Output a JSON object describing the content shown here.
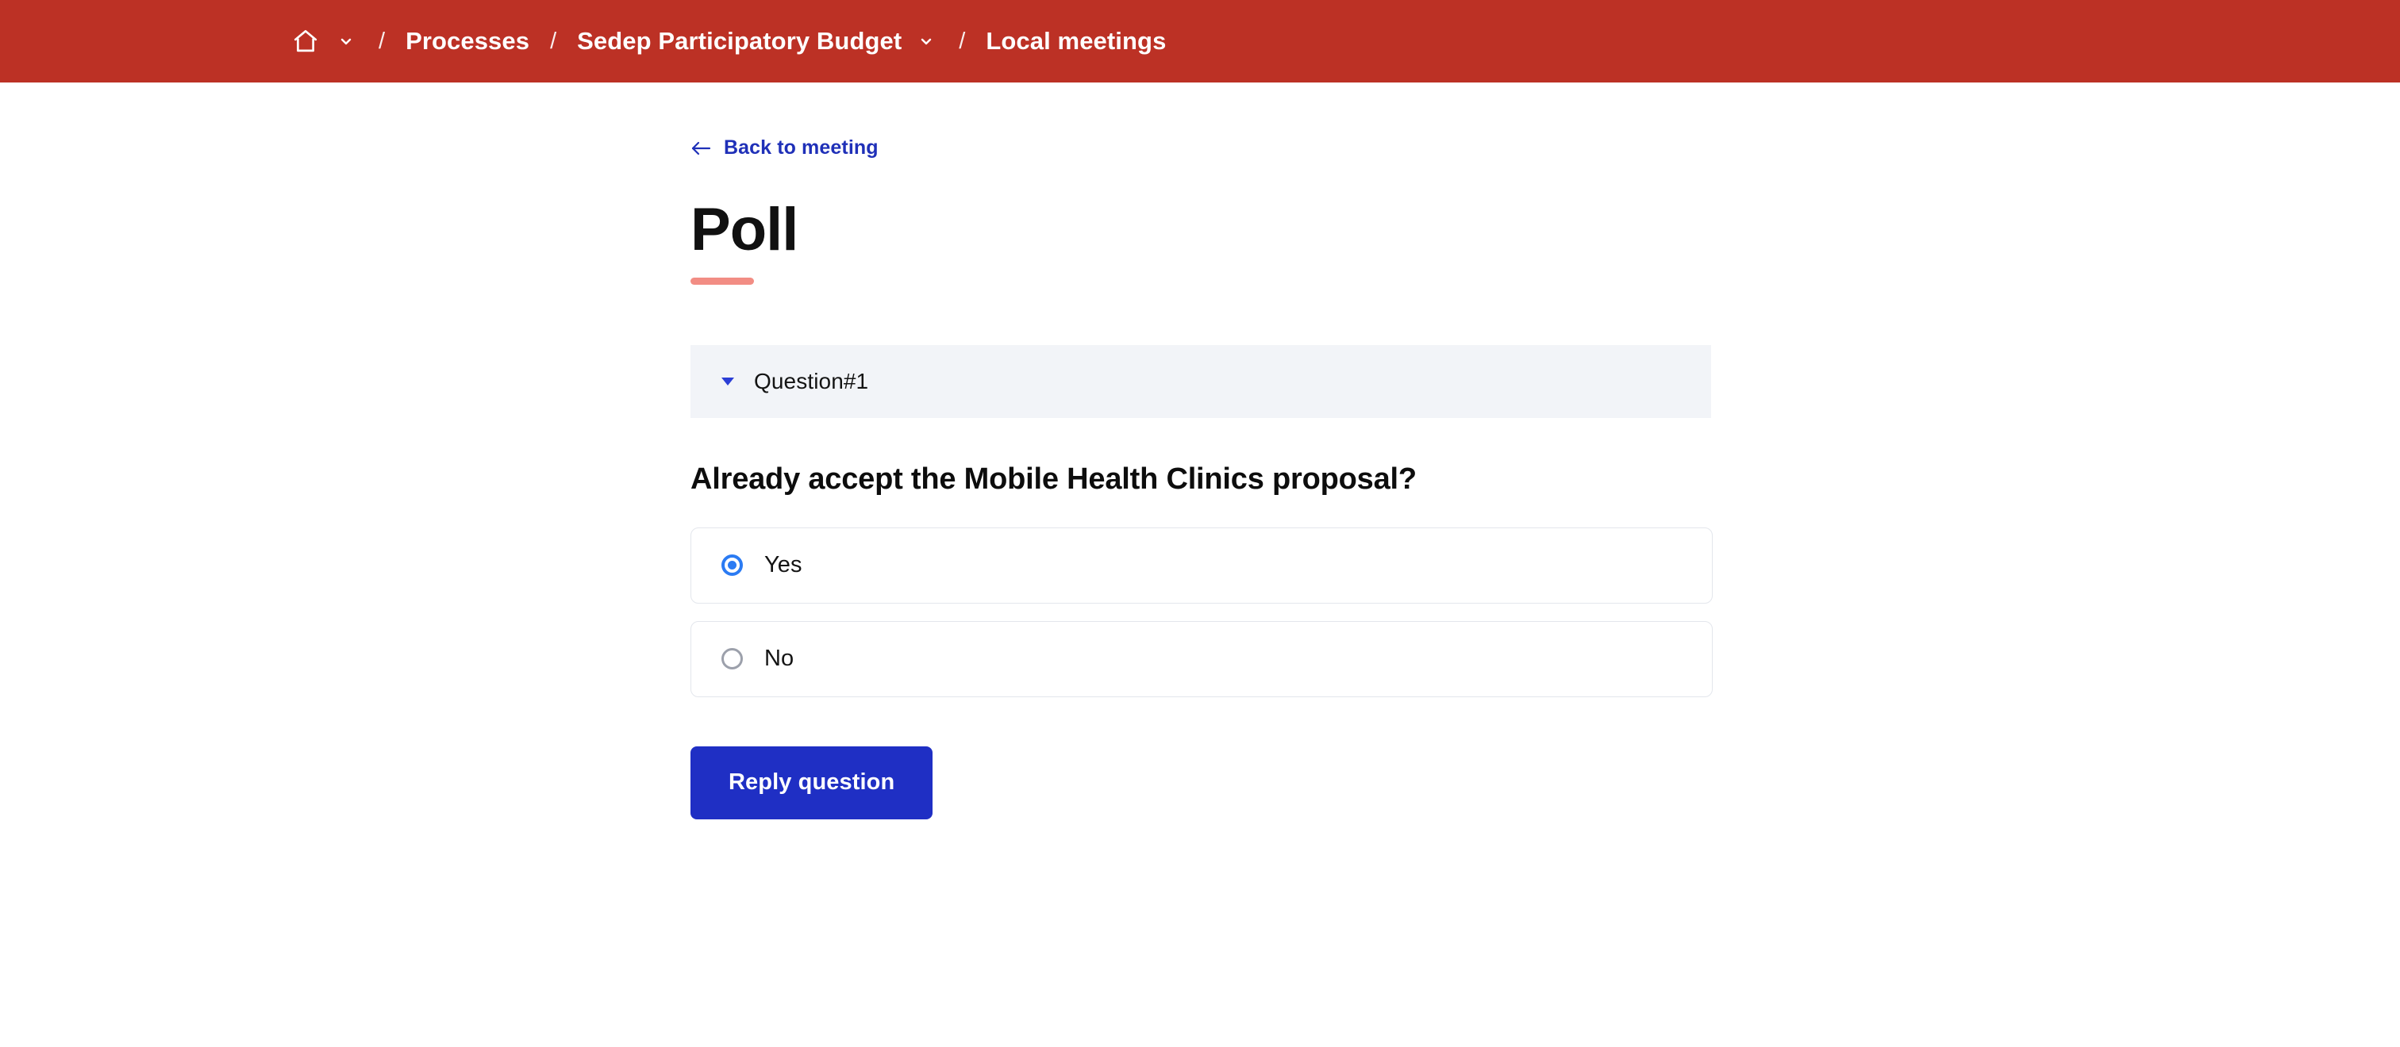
{
  "topbar": {
    "background_color": "#bc3125",
    "home_icon": "home-icon",
    "home_dropdown_icon": "chevron-down-icon",
    "separator": "/",
    "crumbs": [
      {
        "label": "Processes",
        "has_dropdown": false
      },
      {
        "label": "Sedep Participatory Budget",
        "has_dropdown": true
      },
      {
        "label": "Local meetings",
        "has_dropdown": false
      }
    ]
  },
  "back_link": {
    "label": "Back to meeting",
    "icon": "arrow-left-icon",
    "color": "#1f30b8"
  },
  "heading": {
    "title": "Poll",
    "rule_color": "#f28d84"
  },
  "accordion": {
    "caret_icon": "caret-down-icon",
    "caret_color": "#2b3ed6",
    "label": "Question#1",
    "background_color": "#f2f4f8",
    "expanded": true
  },
  "question": {
    "text": "Already accept the Mobile Health Clinics proposal?",
    "options": [
      {
        "label": "Yes",
        "selected": true
      },
      {
        "label": "No",
        "selected": false
      }
    ],
    "selected_color": "#2b7bf3",
    "unselected_color": "#9ca0ab"
  },
  "submit": {
    "label": "Reply question",
    "background_color": "#1f2fc4"
  }
}
